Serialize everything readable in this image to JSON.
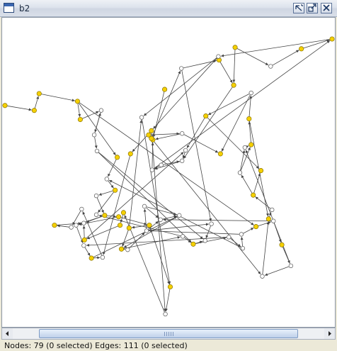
{
  "window": {
    "title": "b2",
    "icon": "window-icon",
    "buttons": [
      {
        "name": "restore-button",
        "icon": "restore-icon"
      },
      {
        "name": "maximize-button",
        "icon": "maximize-icon"
      },
      {
        "name": "close-button",
        "icon": "close-icon"
      }
    ]
  },
  "graph": {
    "colors": {
      "yellow_node": "#f5d000",
      "white_node": "#ffffff",
      "edge": "#444444",
      "node_stroke": "#555555"
    },
    "nodes": [
      {
        "id": 0,
        "c": "yellow"
      },
      {
        "id": 1,
        "c": "yellow"
      },
      {
        "id": 2,
        "c": "yellow"
      },
      {
        "id": 3,
        "c": "yellow"
      },
      {
        "id": 4,
        "c": "yellow"
      },
      {
        "id": 5,
        "c": "white"
      },
      {
        "id": 6,
        "c": "white"
      },
      {
        "id": 7,
        "c": "white"
      },
      {
        "id": 8,
        "c": "yellow"
      },
      {
        "id": 9,
        "c": "white"
      },
      {
        "id": 10,
        "c": "yellow"
      },
      {
        "id": 11,
        "c": "white"
      },
      {
        "id": 12,
        "c": "white"
      },
      {
        "id": 13,
        "c": "yellow"
      },
      {
        "id": 14,
        "c": "yellow"
      },
      {
        "id": 15,
        "c": "yellow"
      },
      {
        "id": 16,
        "c": "yellow"
      },
      {
        "id": 17,
        "c": "yellow"
      },
      {
        "id": 18,
        "c": "white"
      },
      {
        "id": 19,
        "c": "white"
      },
      {
        "id": 20,
        "c": "white"
      },
      {
        "id": 21,
        "c": "white"
      },
      {
        "id": 22,
        "c": "white"
      },
      {
        "id": 23,
        "c": "white"
      },
      {
        "id": 24,
        "c": "yellow"
      },
      {
        "id": 25,
        "c": "white"
      },
      {
        "id": 26,
        "c": "white"
      },
      {
        "id": 27,
        "c": "white"
      },
      {
        "id": 28,
        "c": "white"
      },
      {
        "id": 29,
        "c": "white"
      },
      {
        "id": 30,
        "c": "yellow"
      },
      {
        "id": 31,
        "c": "white"
      },
      {
        "id": 32,
        "c": "yellow"
      },
      {
        "id": 33,
        "c": "white"
      },
      {
        "id": 34,
        "c": "white"
      },
      {
        "id": 35,
        "c": "yellow"
      },
      {
        "id": 36,
        "c": "white"
      },
      {
        "id": 37,
        "c": "yellow"
      },
      {
        "id": 38,
        "c": "yellow"
      },
      {
        "id": 39,
        "c": "white"
      },
      {
        "id": 40,
        "c": "white"
      },
      {
        "id": 41,
        "c": "yellow"
      },
      {
        "id": 42,
        "c": "yellow"
      },
      {
        "id": 43,
        "c": "white"
      },
      {
        "id": 44,
        "c": "yellow"
      },
      {
        "id": 45,
        "c": "yellow"
      },
      {
        "id": 46,
        "c": "white"
      },
      {
        "id": 47,
        "c": "white"
      },
      {
        "id": 48,
        "c": "white"
      },
      {
        "id": 49,
        "c": "yellow"
      },
      {
        "id": 50,
        "c": "white"
      },
      {
        "id": 51,
        "c": "yellow"
      },
      {
        "id": 52,
        "c": "white"
      },
      {
        "id": 53,
        "c": "yellow"
      },
      {
        "id": 54,
        "c": "yellow"
      },
      {
        "id": 55,
        "c": "white"
      },
      {
        "id": 56,
        "c": "yellow"
      },
      {
        "id": 57,
        "c": "yellow"
      },
      {
        "id": 58,
        "c": "yellow"
      },
      {
        "id": 59,
        "c": "white"
      },
      {
        "id": 60,
        "c": "yellow"
      },
      {
        "id": 61,
        "c": "yellow"
      },
      {
        "id": 62,
        "c": "white"
      },
      {
        "id": 63,
        "c": "yellow"
      },
      {
        "id": 64,
        "c": "yellow"
      },
      {
        "id": 65,
        "c": "white"
      },
      {
        "id": 66,
        "c": "yellow"
      },
      {
        "id": 67,
        "c": "white"
      },
      {
        "id": 68,
        "c": "yellow"
      },
      {
        "id": 69,
        "c": "yellow"
      },
      {
        "id": 70,
        "c": "yellow"
      },
      {
        "id": 71,
        "c": "white"
      },
      {
        "id": 72,
        "c": "white"
      },
      {
        "id": 73,
        "c": "white"
      },
      {
        "id": 74,
        "c": "yellow"
      },
      {
        "id": 75,
        "c": "white"
      },
      {
        "id": 76,
        "c": "white"
      },
      {
        "id": 77,
        "c": "white"
      },
      {
        "id": 78,
        "c": "yellow"
      }
    ],
    "edges": [
      [
        0,
        1
      ],
      [
        1,
        2
      ],
      [
        2,
        3
      ],
      [
        3,
        4
      ],
      [
        3,
        30
      ],
      [
        4,
        5
      ],
      [
        5,
        6
      ],
      [
        6,
        7
      ],
      [
        7,
        24
      ],
      [
        24,
        25
      ],
      [
        3,
        8
      ],
      [
        8,
        9
      ],
      [
        9,
        10
      ],
      [
        10,
        11
      ],
      [
        10,
        12
      ],
      [
        11,
        13
      ],
      [
        13,
        14
      ],
      [
        14,
        15
      ],
      [
        15,
        16
      ],
      [
        16,
        17
      ],
      [
        17,
        18
      ],
      [
        18,
        19
      ],
      [
        19,
        26
      ],
      [
        19,
        20
      ],
      [
        20,
        21
      ],
      [
        21,
        22
      ],
      [
        22,
        17
      ],
      [
        17,
        23
      ],
      [
        23,
        24
      ],
      [
        24,
        27
      ],
      [
        27,
        28
      ],
      [
        28,
        29
      ],
      [
        29,
        30
      ],
      [
        30,
        31
      ],
      [
        31,
        32
      ],
      [
        32,
        33
      ],
      [
        33,
        34
      ],
      [
        34,
        35
      ],
      [
        35,
        36
      ],
      [
        36,
        37
      ],
      [
        37,
        38
      ],
      [
        37,
        39
      ],
      [
        39,
        40
      ],
      [
        40,
        41
      ],
      [
        41,
        42
      ],
      [
        42,
        43
      ],
      [
        43,
        44
      ],
      [
        43,
        45
      ],
      [
        45,
        46
      ],
      [
        46,
        47
      ],
      [
        47,
        48
      ],
      [
        48,
        49
      ],
      [
        50,
        48
      ],
      [
        51,
        52
      ],
      [
        52,
        49
      ],
      [
        53,
        49
      ],
      [
        49,
        54
      ],
      [
        54,
        55
      ],
      [
        55,
        56
      ],
      [
        56,
        57
      ],
      [
        58,
        57
      ],
      [
        58,
        59
      ],
      [
        59,
        60
      ],
      [
        60,
        61
      ],
      [
        61,
        62
      ],
      [
        62,
        63
      ],
      [
        63,
        64
      ],
      [
        62,
        65
      ],
      [
        65,
        66
      ],
      [
        66,
        67
      ],
      [
        67,
        68
      ],
      [
        68,
        69
      ],
      [
        69,
        70
      ],
      [
        70,
        71
      ],
      [
        71,
        72
      ],
      [
        72,
        73
      ],
      [
        73,
        74
      ],
      [
        74,
        75
      ],
      [
        75,
        76
      ],
      [
        76,
        77
      ],
      [
        77,
        78
      ],
      [
        78,
        71
      ],
      [
        13,
        71
      ],
      [
        13,
        72
      ],
      [
        64,
        75
      ],
      [
        57,
        47
      ],
      [
        70,
        46
      ],
      [
        52,
        44
      ],
      [
        54,
        34
      ],
      [
        55,
        26
      ],
      [
        20,
        22
      ],
      [
        19,
        21
      ],
      [
        6,
        5
      ],
      [
        7,
        25
      ],
      [
        29,
        19
      ],
      [
        27,
        73
      ],
      [
        28,
        9
      ],
      [
        15,
        66
      ],
      [
        16,
        65
      ],
      [
        39,
        41
      ],
      [
        42,
        35
      ],
      [
        45,
        38
      ],
      [
        23,
        12
      ],
      [
        14,
        72
      ],
      [
        74,
        22
      ],
      [
        26,
        25
      ],
      [
        31,
        21
      ],
      [
        33,
        40
      ],
      [
        48,
        61
      ],
      [
        50,
        47
      ],
      [
        63,
        67
      ]
    ]
  },
  "scrollbar": {
    "left_arrow": "left-arrow-icon",
    "right_arrow": "right-arrow-icon"
  },
  "status": {
    "text": "Nodes: 79 (0 selected) Edges: 111 (0 selected)"
  }
}
